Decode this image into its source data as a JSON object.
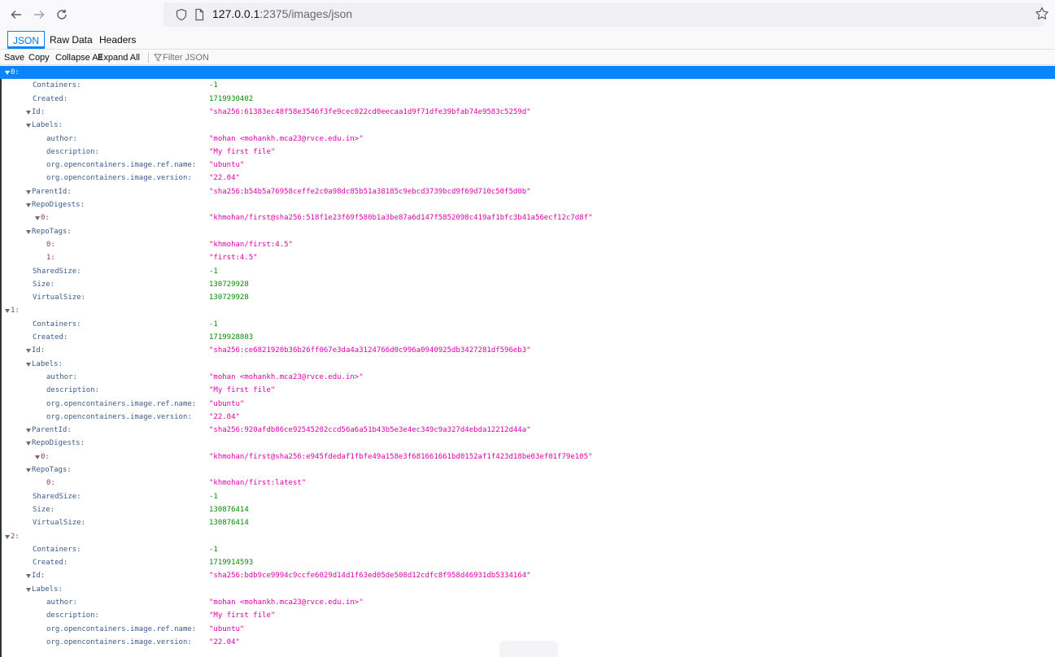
{
  "browser": {
    "url_host": "127.0.0.1",
    "url_rest": ":2375/images/json"
  },
  "viewer": {
    "tabs": [
      "JSON",
      "Raw Data",
      "Headers"
    ],
    "toolbar": {
      "save": "Save",
      "copy": "Copy",
      "collapse_all": "Collapse All",
      "expand_all": "Expand All",
      "filter_placeholder": "Filter JSON"
    }
  },
  "colors": {
    "selection": "#0a84ff",
    "number_value": "#058b00",
    "string_value": "#dd00a9"
  },
  "tree_rows": [
    {
      "depth": 0,
      "key": "0:",
      "toggle": true,
      "selected": true
    },
    {
      "depth": 1,
      "key": "Containers:",
      "value": "-1",
      "vtype": "num"
    },
    {
      "depth": 1,
      "key": "Created:",
      "value": "1719930402",
      "vtype": "num"
    },
    {
      "depth": 1,
      "key": "Id:",
      "value": "\"sha256:61383ec48f58e3546f3fe9cec022cd0eecaa1d9f71dfe39bfab74e9583c5259d\"",
      "vtype": "str",
      "toggle": true
    },
    {
      "depth": 1,
      "key": "Labels:",
      "toggle": true
    },
    {
      "depth": 2,
      "key": "author:",
      "value": "\"mohan <mohankh.mca23@rvce.edu.in>\"",
      "vtype": "str"
    },
    {
      "depth": 2,
      "key": "description:",
      "value": "\"My first file\"",
      "vtype": "str"
    },
    {
      "depth": 2,
      "key": "org.opencontainers.image.ref.name:",
      "value": "\"ubuntu\"",
      "vtype": "str"
    },
    {
      "depth": 2,
      "key": "org.opencontainers.image.version:",
      "value": "\"22.04\"",
      "vtype": "str"
    },
    {
      "depth": 1,
      "key": "ParentId:",
      "value": "\"sha256:b54b5a76958ceffe2c0a98dc85b51a38185c9ebcd3739bcd9f69d710c50f5d0b\"",
      "vtype": "str",
      "toggle": true
    },
    {
      "depth": 1,
      "key": "RepoDigests:",
      "toggle": true
    },
    {
      "depth": 2,
      "key": "0:",
      "value": "\"khmohan/first@sha256:518f1e23f69f580b1a3be87a6d147f5852098c419af1bfc3b41a56ecf12c7d8f\"",
      "vtype": "str",
      "toggle": true
    },
    {
      "depth": 1,
      "key": "RepoTags:",
      "toggle": true
    },
    {
      "depth": 2,
      "key": "0:",
      "value": "\"khmohan/first:4.5\"",
      "vtype": "str"
    },
    {
      "depth": 2,
      "key": "1:",
      "value": "\"first:4.5\"",
      "vtype": "str"
    },
    {
      "depth": 1,
      "key": "SharedSize:",
      "value": "-1",
      "vtype": "num"
    },
    {
      "depth": 1,
      "key": "Size:",
      "value": "130729928",
      "vtype": "num"
    },
    {
      "depth": 1,
      "key": "VirtualSize:",
      "value": "130729928",
      "vtype": "num"
    },
    {
      "depth": 0,
      "key": "1:",
      "toggle": true
    },
    {
      "depth": 1,
      "key": "Containers:",
      "value": "-1",
      "vtype": "num"
    },
    {
      "depth": 1,
      "key": "Created:",
      "value": "1719928803",
      "vtype": "num"
    },
    {
      "depth": 1,
      "key": "Id:",
      "value": "\"sha256:ce6821920b36b26ff067e3da4a3124766d0c996a0940925db3427281df596eb3\"",
      "vtype": "str",
      "toggle": true
    },
    {
      "depth": 1,
      "key": "Labels:",
      "toggle": true
    },
    {
      "depth": 2,
      "key": "author:",
      "value": "\"mohan <mohankh.mca23@rvce.edu.in>\"",
      "vtype": "str"
    },
    {
      "depth": 2,
      "key": "description:",
      "value": "\"My first file\"",
      "vtype": "str"
    },
    {
      "depth": 2,
      "key": "org.opencontainers.image.ref.name:",
      "value": "\"ubuntu\"",
      "vtype": "str"
    },
    {
      "depth": 2,
      "key": "org.opencontainers.image.version:",
      "value": "\"22.04\"",
      "vtype": "str"
    },
    {
      "depth": 1,
      "key": "ParentId:",
      "value": "\"sha256:920afdb86ce92545202ccd56a6a51b43b5e3e4ec349c9a327d4ebda12212d44a\"",
      "vtype": "str",
      "toggle": true
    },
    {
      "depth": 1,
      "key": "RepoDigests:",
      "toggle": true
    },
    {
      "depth": 2,
      "key": "0:",
      "value": "\"khmohan/first@sha256:e945fdedaf1fbfe49a158e3f681661661bd0152af1f423d18be03ef01f79e105\"",
      "vtype": "str",
      "toggle": true
    },
    {
      "depth": 1,
      "key": "RepoTags:",
      "toggle": true
    },
    {
      "depth": 2,
      "key": "0:",
      "value": "\"khmohan/first:latest\"",
      "vtype": "str"
    },
    {
      "depth": 1,
      "key": "SharedSize:",
      "value": "-1",
      "vtype": "num"
    },
    {
      "depth": 1,
      "key": "Size:",
      "value": "130876414",
      "vtype": "num"
    },
    {
      "depth": 1,
      "key": "VirtualSize:",
      "value": "130876414",
      "vtype": "num"
    },
    {
      "depth": 0,
      "key": "2:",
      "toggle": true
    },
    {
      "depth": 1,
      "key": "Containers:",
      "value": "-1",
      "vtype": "num"
    },
    {
      "depth": 1,
      "key": "Created:",
      "value": "1719914593",
      "vtype": "num"
    },
    {
      "depth": 1,
      "key": "Id:",
      "value": "\"sha256:bdb9ce9994c9ccfe6029d14d1f63ed05de508d12cdfc8f958d46931db5334164\"",
      "vtype": "str",
      "toggle": true
    },
    {
      "depth": 1,
      "key": "Labels:",
      "toggle": true
    },
    {
      "depth": 2,
      "key": "author:",
      "value": "\"mohan <mohankh.mca23@rvce.edu.in>\"",
      "vtype": "str"
    },
    {
      "depth": 2,
      "key": "description:",
      "value": "\"My first file\"",
      "vtype": "str"
    },
    {
      "depth": 2,
      "key": "org.opencontainers.image.ref.name:",
      "value": "\"ubuntu\"",
      "vtype": "str"
    },
    {
      "depth": 2,
      "key": "org.opencontainers.image.version:",
      "value": "\"22.04\"",
      "vtype": "str"
    }
  ]
}
